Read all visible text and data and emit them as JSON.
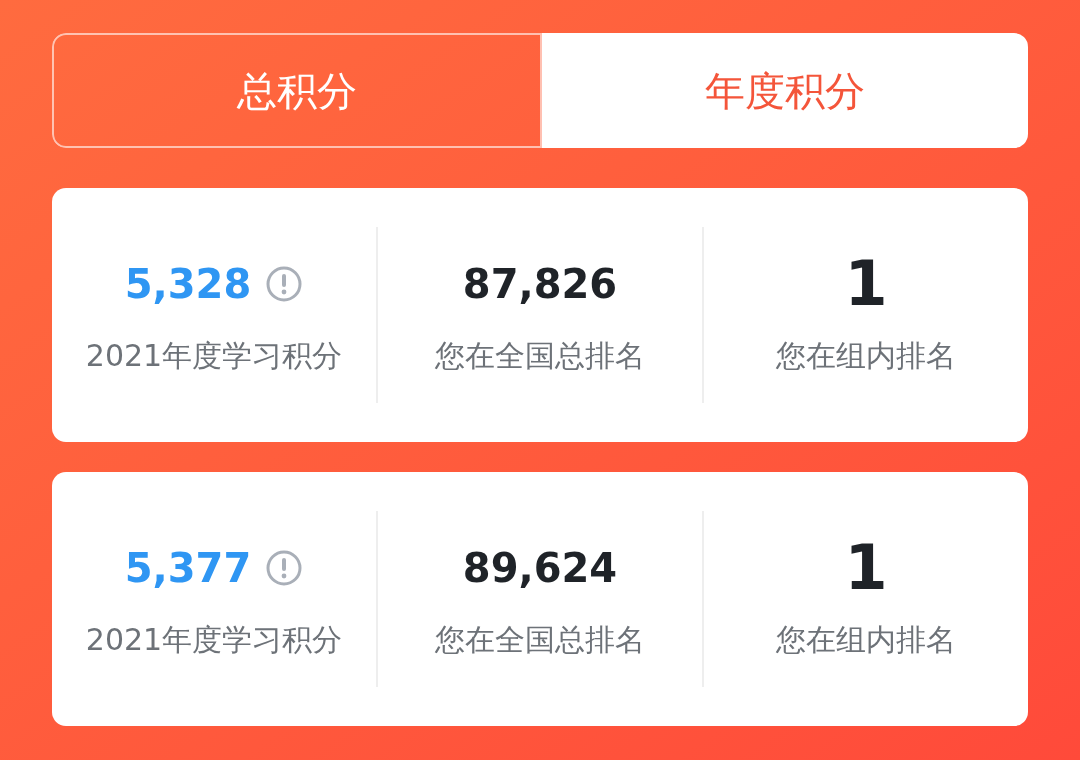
{
  "tabs": [
    {
      "label": "总积分",
      "selected": true
    },
    {
      "label": "年度积分",
      "selected": false
    }
  ],
  "cards": [
    {
      "stats": [
        {
          "kind": "score",
          "value": "5,328",
          "label": "2021年度学习积分"
        },
        {
          "kind": "rank",
          "value": "87,826",
          "label": "您在全国总排名"
        },
        {
          "kind": "big_rank",
          "value": "1",
          "label": "您在组内排名"
        }
      ]
    },
    {
      "stats": [
        {
          "kind": "score",
          "value": "5,377",
          "label": "2021年度学习积分"
        },
        {
          "kind": "rank",
          "value": "89,624",
          "label": "您在全国总排名"
        },
        {
          "kind": "big_rank",
          "value": "1",
          "label": "您在组内排名"
        }
      ]
    }
  ]
}
